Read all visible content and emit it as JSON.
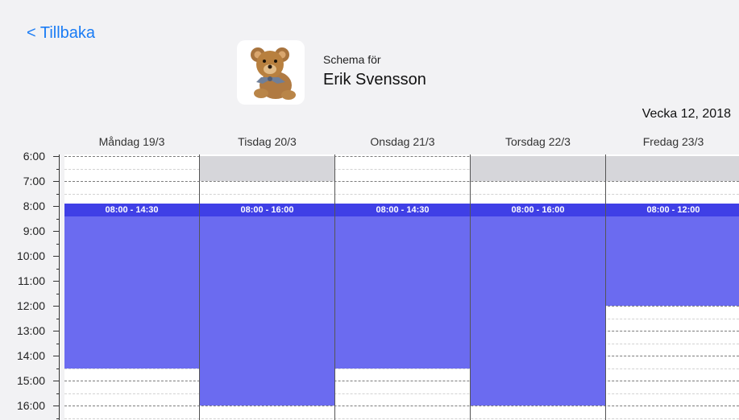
{
  "nav": {
    "back_label": "< Tillbaka"
  },
  "header": {
    "avatar_icon": "teddy-bear-icon",
    "subtitle": "Schema för",
    "name": "Erik Svensson",
    "week": "Vecka 12, 2018"
  },
  "schedule": {
    "days": [
      {
        "label": "Måndag 19/3",
        "shift": "08:00 - 14:30",
        "start": 8,
        "end": 14.5,
        "off_before": null
      },
      {
        "label": "Tisdag 20/3",
        "shift": "08:00 - 16:00",
        "start": 8,
        "end": 16,
        "off_before": [
          6,
          7
        ]
      },
      {
        "label": "Onsdag 21/3",
        "shift": "08:00 - 14:30",
        "start": 8,
        "end": 14.5,
        "off_before": null
      },
      {
        "label": "Torsdag 22/3",
        "shift": "08:00 - 16:00",
        "start": 8,
        "end": 16,
        "off_before": [
          6,
          7
        ]
      },
      {
        "label": "Fredag 23/3",
        "shift": "08:00 - 12:00",
        "start": 8,
        "end": 12,
        "off_before": [
          6,
          7
        ]
      }
    ],
    "hours": [
      "6:00",
      "7:00",
      "8:00",
      "9:00",
      "10:00",
      "11:00",
      "12:00",
      "13:00",
      "14:00",
      "15:00",
      "16:00"
    ],
    "colors": {
      "shift_fill": "#6b6bf0",
      "shift_bar": "#3f3fe6",
      "off_fill": "#d6d6da",
      "link": "#1a7cf5"
    }
  }
}
